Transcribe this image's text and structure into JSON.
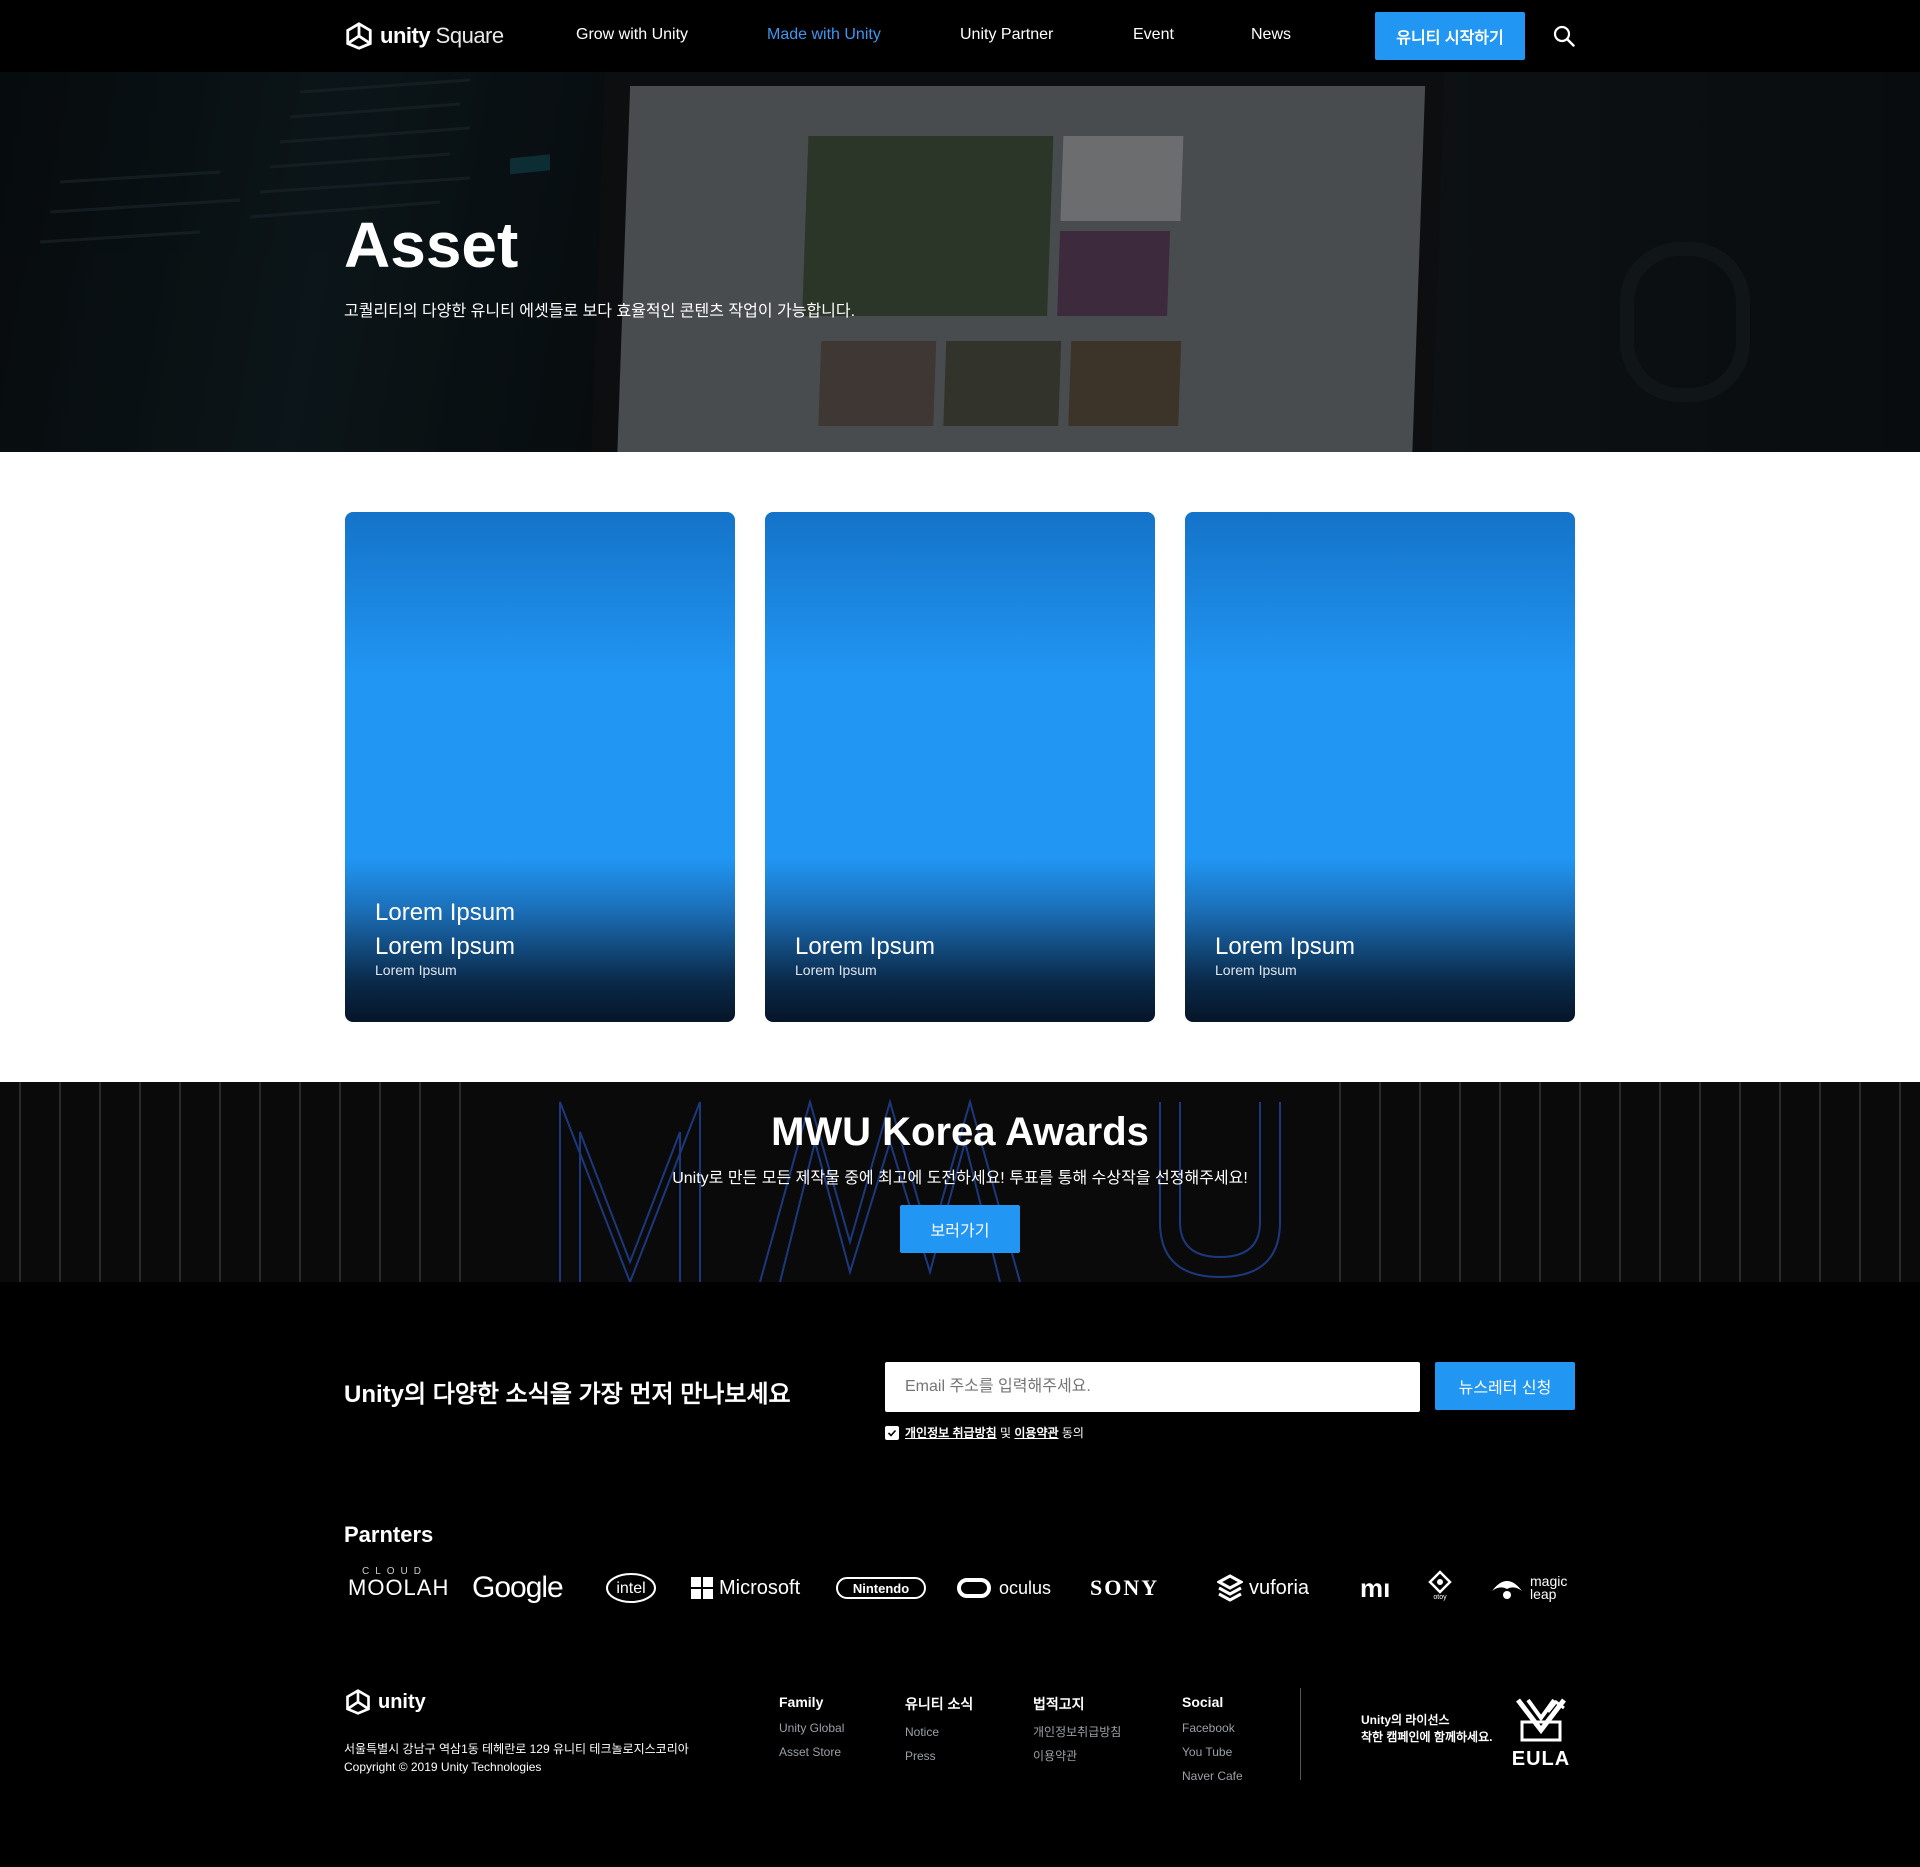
{
  "header": {
    "logo_bold": "unity",
    "logo_light": " Square",
    "nav": [
      {
        "label": "Grow with Unity",
        "active": false
      },
      {
        "label": "Made with Unity",
        "active": true
      },
      {
        "label": "Unity Partner",
        "active": false
      },
      {
        "label": "Event",
        "active": false
      },
      {
        "label": "News",
        "active": false
      }
    ],
    "cta_label": "유니티 시작하기",
    "search_icon": "search-icon"
  },
  "hero": {
    "title": "Asset",
    "subtitle": "고퀄리티의 다양한 유니티 에셋들로 보다 효율적인 콘텐츠 작업이 가능합니다."
  },
  "cards": [
    {
      "title_lines": [
        "Lorem Ipsum",
        "Lorem Ipsum"
      ],
      "subtitle": "Lorem Ipsum"
    },
    {
      "title_lines": [
        "Lorem Ipsum"
      ],
      "subtitle": "Lorem Ipsum"
    },
    {
      "title_lines": [
        "Lorem Ipsum"
      ],
      "subtitle": "Lorem Ipsum"
    }
  ],
  "awards": {
    "title": "MWU Korea Awards",
    "subtitle": "Unity로 만든 모든 제작물 중에 최고에 도전하세요! 투표를 통해 수상작을 선정해주세요!",
    "button_label": "보러가기"
  },
  "newsletter": {
    "title": "Unity의 다양한 소식을 가장 먼저 만나보세요",
    "input_placeholder": "Email 주소를 입력해주세요.",
    "button_label": "뉴스레터 신청",
    "agree_privacy": "개인정보 취급방침",
    "agree_and": " 및 ",
    "agree_terms": "이용약관",
    "agree_suffix": " 동의"
  },
  "partners": {
    "title": "Parnters",
    "logos": [
      "CLOUD MOOLAH",
      "Google",
      "intel",
      "Microsoft",
      "Nintendo",
      "oculus",
      "SONY",
      "vuforia",
      "mi",
      "otoy",
      "magic leap"
    ]
  },
  "footer": {
    "logo_text": "unity",
    "address": "서울특별시 강남구 역삼1동 테헤란로 129 유니티 테크놀로지스코리아",
    "copyright": "Copyright © 2019 Unity Technologies",
    "columns": [
      {
        "head": "Family",
        "items": [
          "Unity Global",
          "Asset Store"
        ]
      },
      {
        "head": "유니티 소식",
        "items": [
          "Notice",
          "Press"
        ]
      },
      {
        "head": "법적고지",
        "items": [
          "개인정보취급방침",
          "이용약관"
        ]
      },
      {
        "head": "Social",
        "items": [
          "Facebook",
          "You Tube",
          "Naver Cafe"
        ]
      }
    ],
    "license_line1": "Unity의 라이선스",
    "license_line2": "착한 캠페인에 함께하세요.",
    "eula_text": "EULA"
  },
  "colors": {
    "accent": "#2196f3",
    "nav_active": "#3c97f0",
    "background": "#000000"
  }
}
